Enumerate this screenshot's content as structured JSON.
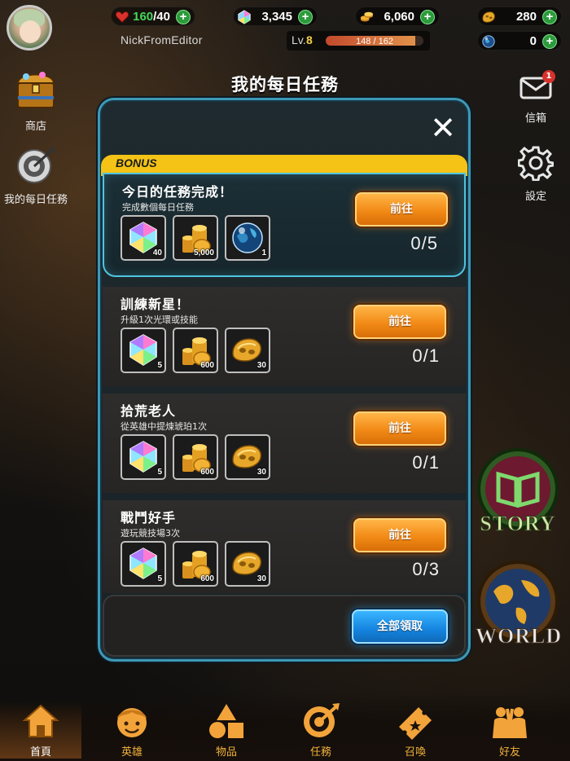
{
  "header": {
    "username": "NickFromEditor",
    "level_label": "Lv.",
    "level_value": "8",
    "xp_text": "148 / 162",
    "xp_fraction": 0.914,
    "resources": [
      {
        "name": "hearts",
        "value": "160",
        "suffix": "/40",
        "icon": "heart-icon",
        "color": "#d8322c"
      },
      {
        "name": "gems",
        "value": "3,345",
        "icon": "gem-icon"
      },
      {
        "name": "coins",
        "value": "6,060",
        "icon": "coin-icon"
      },
      {
        "name": "amber",
        "value": "280",
        "icon": "amber-icon"
      },
      {
        "name": "orbs",
        "value": "0",
        "icon": "orb-icon"
      }
    ]
  },
  "sidebar_left": {
    "shop_label": "商店",
    "daily_tasks_label": "我的每日任務"
  },
  "sidebar_right": {
    "mail_label": "信箱",
    "mail_badge": "1",
    "settings_label": "設定"
  },
  "page_title": "我的每日任務",
  "panel": {
    "bonus_label": "BONUS",
    "go_label": "前往",
    "claim_all_label": "全部領取",
    "tasks": [
      {
        "title": "今日的任務完成！",
        "desc": "完成數個每日任務",
        "progress": "0/5",
        "rewards": [
          {
            "icon": "rainbow-gem-icon",
            "qty": "40"
          },
          {
            "icon": "gold-coins-icon",
            "qty": "5,000"
          },
          {
            "icon": "blue-orb-icon",
            "qty": "1"
          }
        ]
      },
      {
        "title": "訓練新星！",
        "desc": "升級1次光環或技能",
        "progress": "0/1",
        "rewards": [
          {
            "icon": "rainbow-gem-icon",
            "qty": "5"
          },
          {
            "icon": "gold-coins-icon",
            "qty": "600"
          },
          {
            "icon": "amber-icon",
            "qty": "30"
          }
        ]
      },
      {
        "title": "拾荒老人",
        "desc": "從英雄中提煉琥珀1次",
        "progress": "0/1",
        "rewards": [
          {
            "icon": "rainbow-gem-icon",
            "qty": "5"
          },
          {
            "icon": "gold-coins-icon",
            "qty": "600"
          },
          {
            "icon": "amber-icon",
            "qty": "30"
          }
        ]
      },
      {
        "title": "戰鬥好手",
        "desc": "遊玩競技場3次",
        "progress": "0/3",
        "rewards": [
          {
            "icon": "rainbow-gem-icon",
            "qty": "5"
          },
          {
            "icon": "gold-coins-icon",
            "qty": "600"
          },
          {
            "icon": "amber-icon",
            "qty": "30"
          }
        ]
      }
    ]
  },
  "side_buttons": {
    "story_label": "STORY",
    "world_label": "WORLD"
  },
  "bottom_nav": [
    {
      "label": "首頁",
      "icon": "home-icon",
      "active": true
    },
    {
      "label": "英雄",
      "icon": "hero-face-icon",
      "active": false
    },
    {
      "label": "物品",
      "icon": "shapes-icon",
      "active": false
    },
    {
      "label": "任務",
      "icon": "target-icon",
      "active": false
    },
    {
      "label": "召喚",
      "icon": "ticket-icon",
      "active": false
    },
    {
      "label": "好友",
      "icon": "friends-icon",
      "active": false
    }
  ],
  "colors": {
    "accent_orange": "#f28a16",
    "accent_blue": "#1584e0",
    "panel_border": "#3f98b6",
    "bonus_yellow": "#f4c316",
    "nav_label": "#f2b23c"
  }
}
